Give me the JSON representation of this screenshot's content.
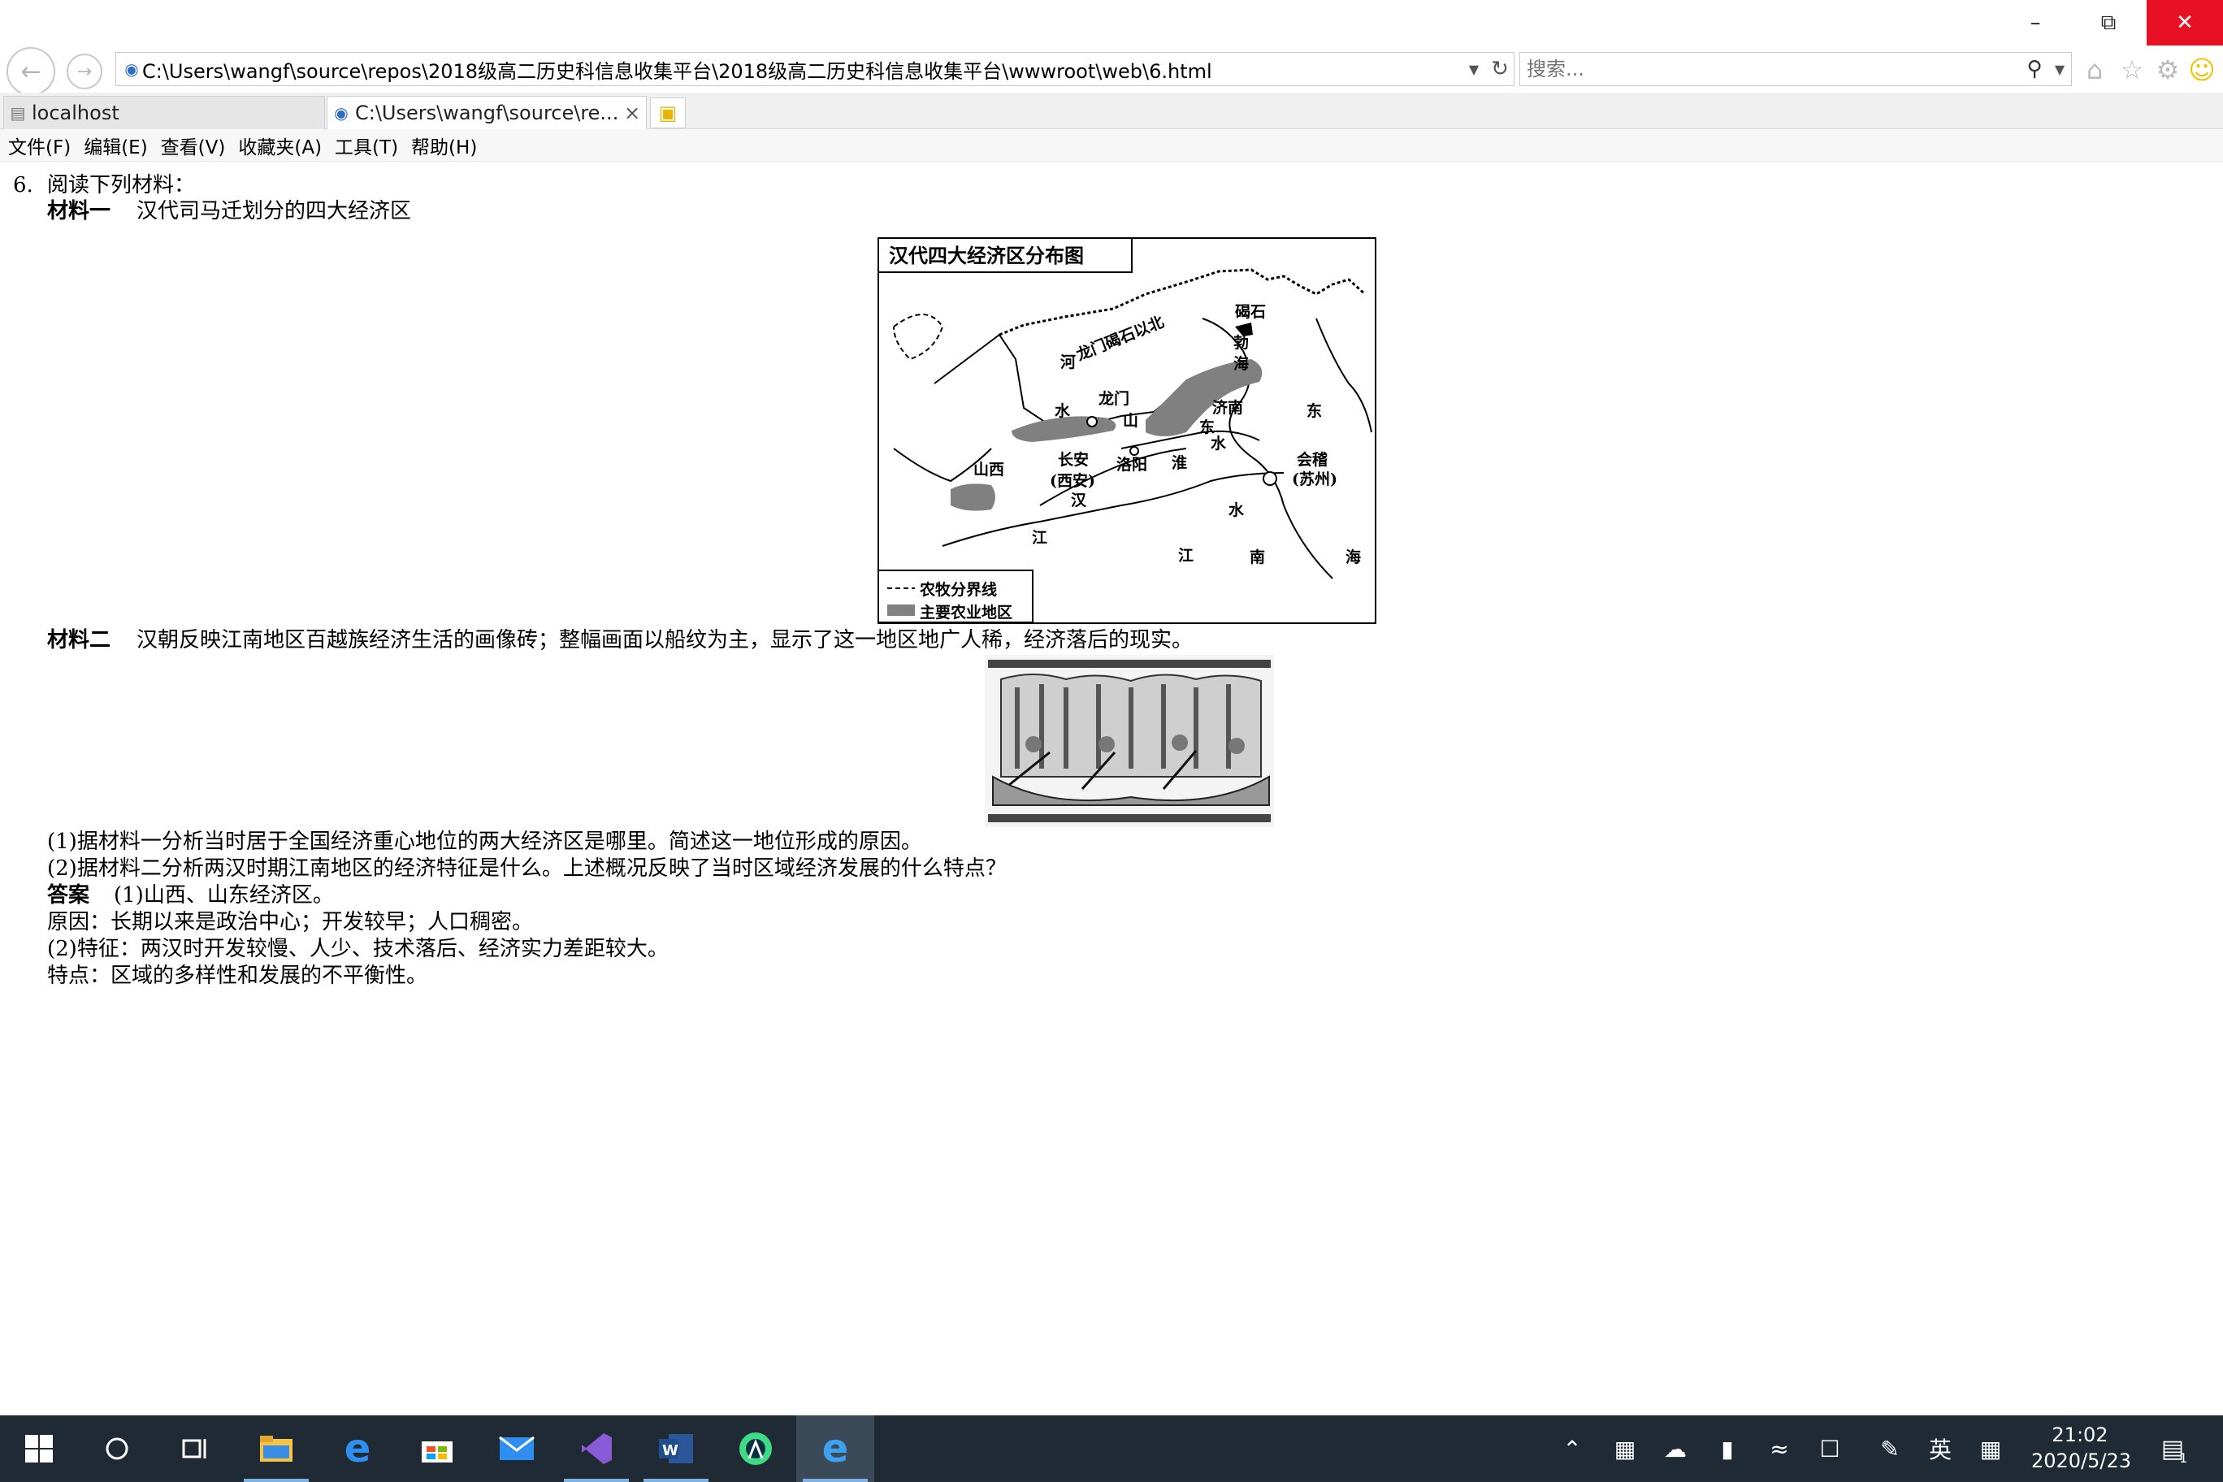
{
  "window": {
    "minimize": "–",
    "restore": "⧉",
    "close": "✕"
  },
  "nav": {
    "back": "←",
    "forward": "→",
    "address": "C:\\Users\\wangf\\source\\repos\\2018级高二历史科信息收集平台\\2018级高二历史科信息收集平台\\wwwroot\\web\\6.html",
    "search_placeholder": "搜索..."
  },
  "tabs": [
    {
      "label": "localhost"
    },
    {
      "label": "C:\\Users\\wangf\\source\\re..."
    }
  ],
  "menu": [
    "文件(F)",
    "编辑(E)",
    "查看(V)",
    "收藏夹(A)",
    "工具(T)",
    "帮助(H)"
  ],
  "question": {
    "number": "6.",
    "intro": "阅读下列材料：",
    "m1_label": "材料一",
    "m1_text": "汉代司马迁划分的四大经济区",
    "m2_label": "材料二",
    "m2_text": "汉朝反映江南地区百越族经济生活的画像砖；整幅画面以船纹为主，显示了这一地区地广人稀，经济落后的现实。",
    "sub1": "(1)据材料一分析当时居于全国经济重心地位的两大经济区是哪里。简述这一地位形成的原因。",
    "sub2": "(2)据材料二分析两汉时期江南地区的经济特征是什么。上述概况反映了当时区域经济发展的什么特点？",
    "answer_label": "答案",
    "answer1": "(1)山西、山东经济区。",
    "reason": "原因：长期以来是政治中心；开发较早；人口稠密。",
    "answer2": "(2)特征：两汉时开发较慢、人少、技术落后、经济实力差距较大。",
    "feature": "特点：区域的多样性和发展的不平衡性。"
  },
  "map": {
    "title": "汉代四大经济区分布图",
    "labels": {
      "longmen_jieshi": "龙门碣石以北",
      "jieshi": "碣石",
      "bo": "勃",
      "hai_bohai": "海",
      "he": "河",
      "shui": "水",
      "longmen": "龙门",
      "shan": "山",
      "jinan": "济南",
      "dong": "东",
      "dong2": "东",
      "shui2": "水",
      "shanxi": "山西",
      "changan": "长安",
      "xian": "(西安)",
      "luoyang": "洛阳",
      "huai": "淮",
      "kuaiji": "会稽",
      "suzhou": "(苏州)",
      "han": "汉",
      "shui3": "水",
      "jiang": "江",
      "jiang2": "江",
      "nan": "南",
      "hai": "海"
    },
    "legend": {
      "boundary": "农牧分界线",
      "agri": "主要农业地区"
    }
  },
  "taskbar": {
    "ime": "英",
    "time": "21:02",
    "date": "2020/5/23",
    "notif_count": "1"
  }
}
